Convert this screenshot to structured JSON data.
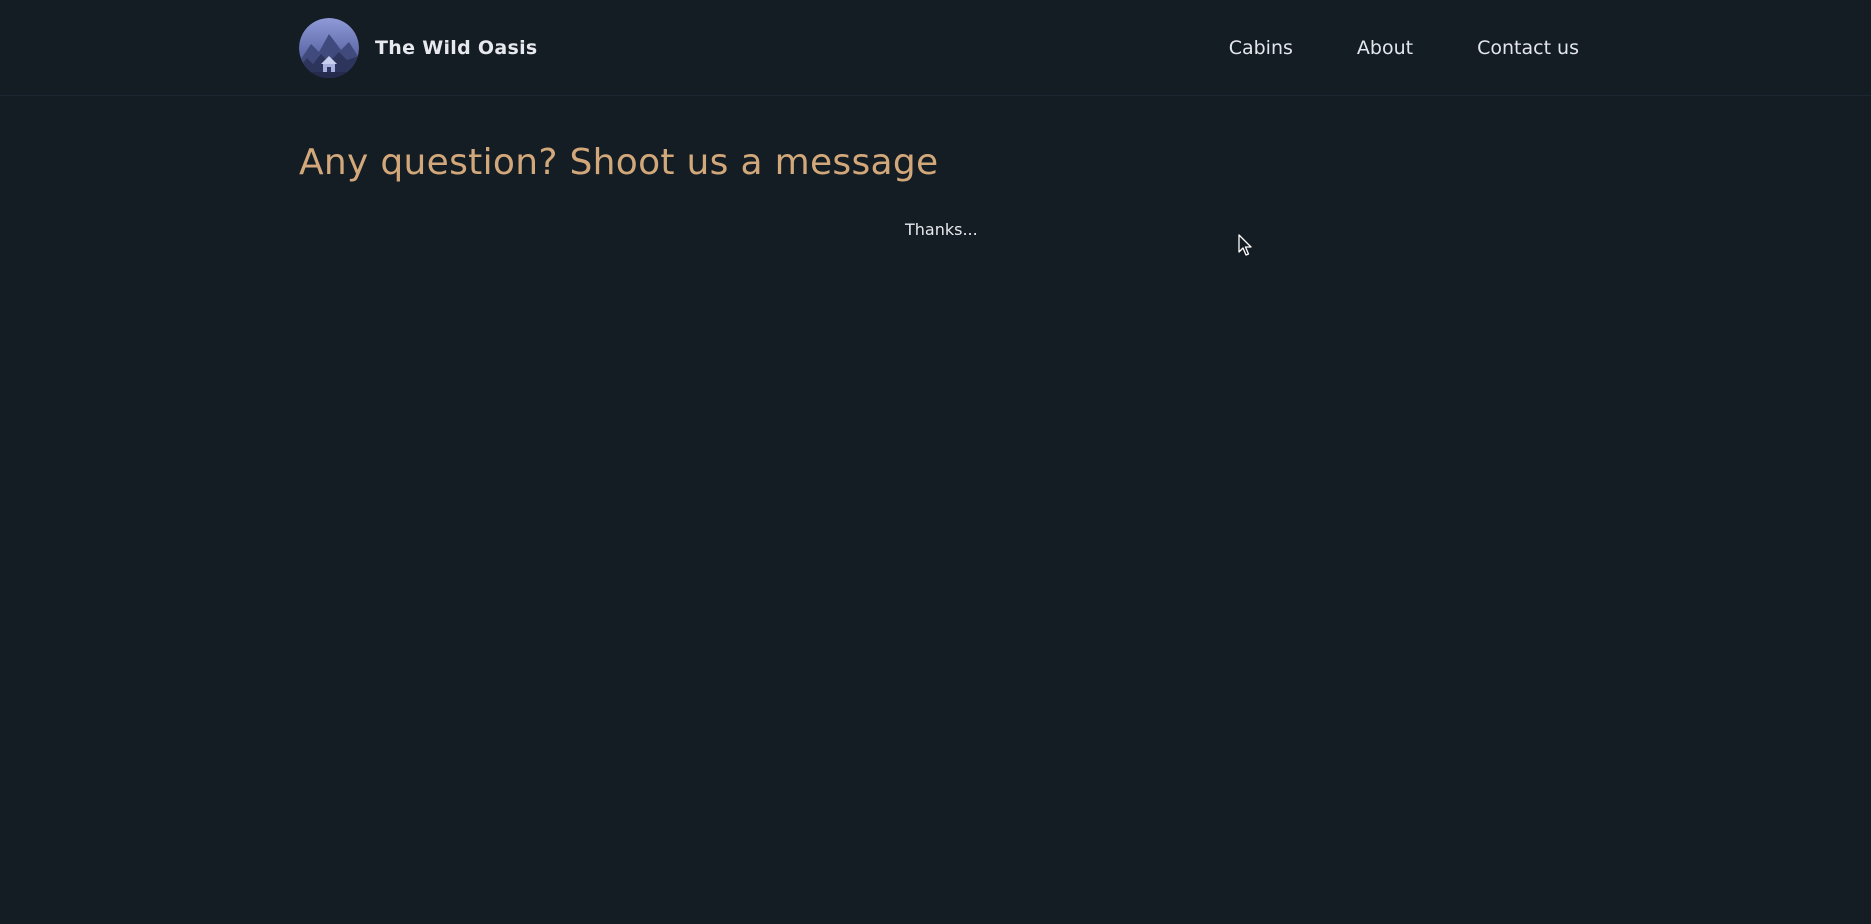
{
  "header": {
    "brand_name": "The Wild Oasis",
    "logo_icon": "mountain-cabin-logo",
    "nav": [
      {
        "label": "Cabins"
      },
      {
        "label": "About"
      },
      {
        "label": "Contact us"
      }
    ]
  },
  "main": {
    "title": "Any question? Shoot us a message",
    "status": "Thanks..."
  },
  "colors": {
    "background": "#141c24",
    "accent": "#d2a87a",
    "text": "#e4e7ec"
  }
}
